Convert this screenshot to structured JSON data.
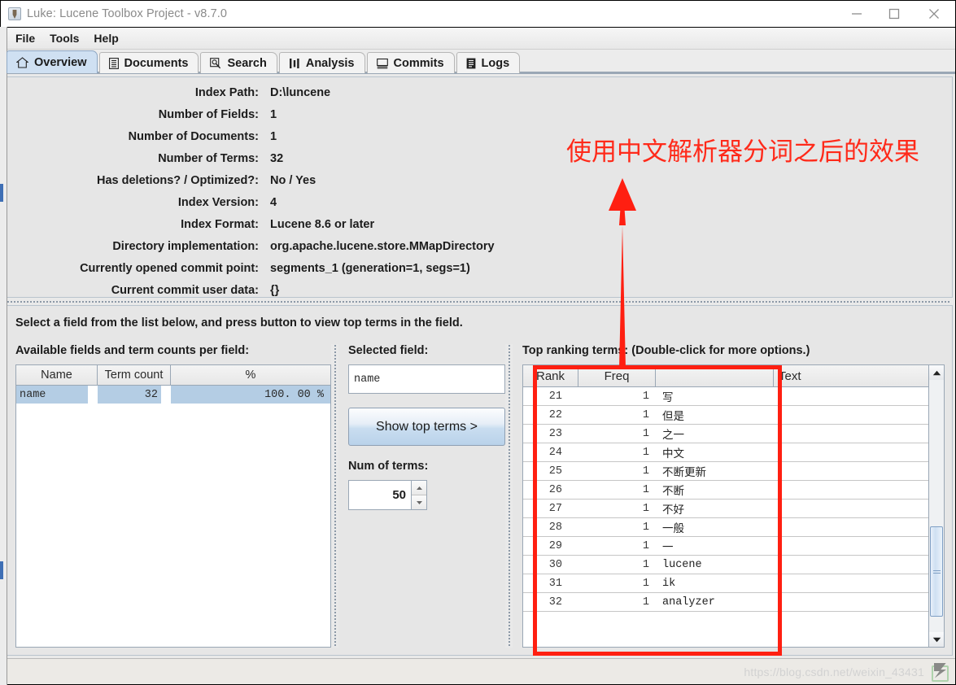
{
  "window": {
    "title": "Luke: Lucene Toolbox Project - v8.7.0",
    "icon": "java-coffee-cup-icon",
    "controls": {
      "minimize": "minimize-icon",
      "maximize": "maximize-icon",
      "close": "close-icon"
    }
  },
  "menubar": {
    "items": [
      "File",
      "Tools",
      "Help"
    ]
  },
  "tabs": [
    {
      "label": "Overview",
      "icon": "home-icon",
      "active": true
    },
    {
      "label": "Documents",
      "icon": "document-icon",
      "active": false
    },
    {
      "label": "Search",
      "icon": "search-icon",
      "active": false
    },
    {
      "label": "Analysis",
      "icon": "analysis-icon",
      "active": false
    },
    {
      "label": "Commits",
      "icon": "commits-icon",
      "active": false
    },
    {
      "label": "Logs",
      "icon": "logs-icon",
      "active": false
    }
  ],
  "overview": {
    "rows": [
      {
        "label": "Index Path:",
        "value": "D:\\luncene"
      },
      {
        "label": "Number of Fields:",
        "value": "1"
      },
      {
        "label": "Number of Documents:",
        "value": "1"
      },
      {
        "label": "Number of Terms:",
        "value": "32"
      },
      {
        "label": "Has deletions? / Optimized?:",
        "value": "No / Yes"
      },
      {
        "label": "Index Version:",
        "value": "4"
      },
      {
        "label": "Index Format:",
        "value": "Lucene 8.6 or later"
      },
      {
        "label": "Directory implementation:",
        "value": "org.apache.lucene.store.MMapDirectory"
      },
      {
        "label": "Currently opened commit point:",
        "value": "segments_1 (generation=1, segs=1)"
      },
      {
        "label": "Current commit user data:",
        "value": "{}"
      }
    ]
  },
  "fields_panel": {
    "hint": "Select a field from the list below, and press button to view top terms in the field.",
    "table_label": "Available fields and term counts per field:",
    "columns": [
      "Name",
      "Term count",
      "%"
    ],
    "rows": [
      {
        "name": "name",
        "term_count": "32",
        "percent": "100. 00  %",
        "selected": true
      }
    ]
  },
  "selected_field_panel": {
    "label": "Selected field:",
    "field_value": "name",
    "button_label": "Show top terms >",
    "num_terms_label": "Num of terms:",
    "num_terms_value": "50",
    "spinner_up": "spinner-up-icon",
    "spinner_down": "spinner-down-icon"
  },
  "terms_panel": {
    "title": "Top ranking terms: (Double-click for more options.)",
    "columns": [
      "Rank",
      "Freq",
      "",
      "Text"
    ],
    "rows": [
      {
        "rank": "21",
        "freq": "1",
        "term": "写",
        "text": ""
      },
      {
        "rank": "22",
        "freq": "1",
        "term": "但是",
        "text": ""
      },
      {
        "rank": "23",
        "freq": "1",
        "term": "之一",
        "text": ""
      },
      {
        "rank": "24",
        "freq": "1",
        "term": "中文",
        "text": ""
      },
      {
        "rank": "25",
        "freq": "1",
        "term": "不断更新",
        "text": ""
      },
      {
        "rank": "26",
        "freq": "1",
        "term": "不断",
        "text": ""
      },
      {
        "rank": "27",
        "freq": "1",
        "term": "不好",
        "text": ""
      },
      {
        "rank": "28",
        "freq": "1",
        "term": "一般",
        "text": ""
      },
      {
        "rank": "29",
        "freq": "1",
        "term": "一",
        "text": ""
      },
      {
        "rank": "30",
        "freq": "1",
        "term": "lucene",
        "text": ""
      },
      {
        "rank": "31",
        "freq": "1",
        "term": "ik",
        "text": ""
      },
      {
        "rank": "32",
        "freq": "1",
        "term": "analyzer",
        "text": ""
      }
    ],
    "scrollbar": {
      "up_icon": "scroll-up-icon",
      "down_icon": "scroll-down-icon",
      "thumb_position": "near-bottom"
    }
  },
  "annotation": {
    "text": "使用中文解析器分词之后的效果",
    "color": "#ff2a1a",
    "arrow": "up-arrow-annotation",
    "rectangle": "highlight-rectangle"
  },
  "statusbar": {
    "watermark": "https://blog.csdn.net/weixin_43431",
    "logo": "csdn-logo-icon"
  }
}
